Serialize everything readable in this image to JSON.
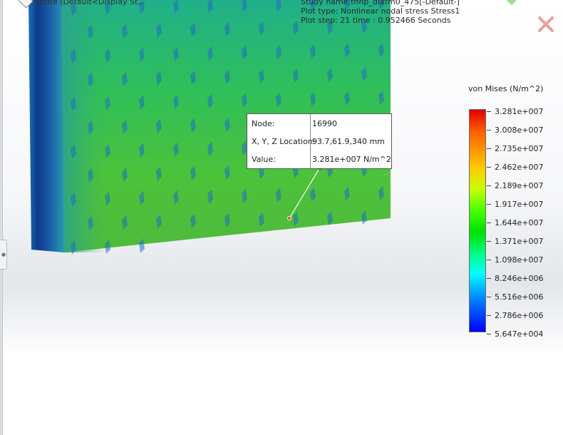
{
  "tree": {
    "label": "Bottle (Default<Display St..."
  },
  "study": {
    "name_line": "Study name:thnp_diatm0_475[-Default-]",
    "plot_type_line": "Plot type: Nonlinear nodal stress Stress1",
    "plot_step_line": "Plot step: 21   time : 0.952466 Seconds"
  },
  "probe": {
    "rows": [
      {
        "label": "Node:",
        "value": "16990"
      },
      {
        "label": "X, Y, Z Location:",
        "value": "93.7,61.9,340 mm"
      },
      {
        "label": "Value:",
        "value": "3.281e+007 N/m^2"
      }
    ]
  },
  "legend": {
    "title": "von Mises (N/m^2)",
    "labels": [
      "3.281e+007",
      "3.008e+007",
      "2.735e+007",
      "2.462e+007",
      "2.189e+007",
      "1.917e+007",
      "1.644e+007",
      "1.371e+007",
      "1.098e+007",
      "8.246e+006",
      "5.516e+006",
      "2.786e+006",
      "5.647e+004"
    ]
  },
  "colors": {
    "ok_check": "#a3d99b",
    "cancel_x": "#e8a0a0",
    "model_green": "#3fbf46",
    "model_blue_edge": "#0f3f8a"
  }
}
